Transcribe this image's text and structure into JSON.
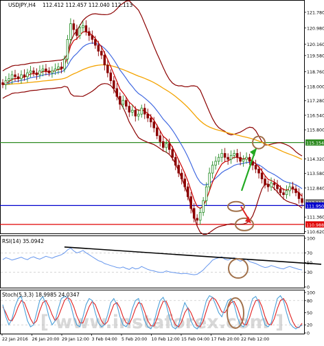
{
  "header": {
    "symbol_timeframe": "USDJPY,H4",
    "ohlc": "112.412 112.457 112.040 112.113"
  },
  "watermark": "www.instaforex.com",
  "colors": {
    "background": "#ffffff",
    "bull_candle": "#228b22",
    "bear_candle": "#8b0000",
    "bollinger": "#8b0000",
    "ema_fast": "#cc0000",
    "ema_mid": "#4169e1",
    "ema_slow": "#f4a300",
    "resistance": "#2e8b22",
    "support": "#0000cd",
    "target_low": "#e00000",
    "rsi_line": "#6495ed",
    "stoch_main": "#4a9fd8",
    "stoch_signal": "#e02020",
    "annotation_circle": "#a0704a",
    "trend_line": "#000000",
    "arrow_up": "#22aa22",
    "arrow_down": "#dd2222"
  },
  "chart_data": [
    {
      "type": "candlestick",
      "title": "USDJPY,H4",
      "ylim": [
        110.6,
        122.3
      ],
      "y_ticks": [
        "121.780",
        "120.980",
        "120.160",
        "119.580",
        "118.760",
        "118.000",
        "117.280",
        "116.540",
        "115.800",
        "115.154",
        "114.320",
        "113.580",
        "112.840",
        "112.113",
        "111.950",
        "111.360",
        "110.988",
        "110.620"
      ],
      "price_labels": {
        "current": "112.113",
        "support": "111.950",
        "resistance": "115.154",
        "target_low": "110.988"
      },
      "levels": [
        {
          "name": "resistance",
          "value": 115.154
        },
        {
          "name": "support",
          "value": 111.95
        },
        {
          "name": "target_low",
          "value": 110.988
        }
      ],
      "x_ticks": [
        "22 Jan 2016",
        "26 Jan 20:00",
        "29 Jan 12:00",
        "3 Feb 04:00",
        "5 Feb 20:00",
        "10 Feb 12:00",
        "15 Feb 04:00",
        "17 Feb 20:00",
        "22 Feb 12:00"
      ],
      "closes": [
        118.1,
        118.3,
        118.4,
        118.6,
        118.5,
        118.4,
        118.6,
        118.5,
        118.7,
        118.8,
        118.7,
        118.6,
        118.8,
        118.9,
        118.8,
        118.7,
        118.8,
        118.9,
        119.0,
        118.9,
        119.4,
        120.4,
        121.2,
        120.9,
        120.6,
        121.0,
        121.1,
        120.8,
        120.6,
        120.4,
        120.1,
        119.8,
        119.6,
        119.1,
        118.7,
        118.3,
        117.9,
        117.5,
        117.1,
        117.3,
        117.0,
        116.7,
        116.8,
        116.5,
        116.6,
        116.9,
        116.6,
        116.4,
        116.2,
        115.9,
        115.5,
        115.2,
        114.9,
        115.1,
        114.8,
        114.4,
        114.0,
        113.6,
        113.3,
        112.9,
        112.4,
        111.8,
        111.3,
        111.2,
        111.6,
        112.2,
        112.9,
        113.6,
        114.0,
        114.2,
        114.4,
        114.6,
        114.4,
        114.3,
        114.5,
        114.6,
        114.4,
        114.2,
        114.3,
        114.4,
        114.2,
        114.0,
        113.8,
        113.6,
        113.3,
        113.0,
        112.9,
        113.1,
        113.0,
        112.8,
        112.6,
        112.5,
        112.7,
        112.9,
        112.8,
        112.6,
        112.3,
        112.1
      ],
      "annotations": [
        "circle-resistance-target",
        "circle-current-price",
        "circle-low-target",
        "arrow-up",
        "arrow-down"
      ]
    },
    {
      "type": "line",
      "title": "RSI(14) 35.0942",
      "ylim": [
        0,
        100
      ],
      "y_ticks": [
        "100",
        "70",
        "50",
        "30",
        "0"
      ],
      "series": [
        {
          "name": "RSI(14)",
          "values": [
            56,
            60,
            58,
            55,
            57,
            59,
            61,
            58,
            56,
            60,
            62,
            59,
            57,
            60,
            63,
            61,
            59,
            62,
            64,
            66,
            70,
            76,
            80,
            74,
            70,
            72,
            75,
            70,
            66,
            62,
            58,
            54,
            52,
            48,
            46,
            44,
            42,
            40,
            39,
            41,
            38,
            36,
            40,
            37,
            38,
            42,
            39,
            36,
            34,
            33,
            31,
            30,
            30,
            33,
            31,
            30,
            29,
            28,
            27,
            28,
            27,
            26,
            25,
            26,
            30,
            35,
            42,
            48,
            55,
            58,
            60,
            62,
            57,
            55,
            58,
            60,
            56,
            53,
            55,
            57,
            52,
            50,
            48,
            45,
            42,
            40,
            41,
            44,
            42,
            40,
            38,
            37,
            40,
            42,
            40,
            38,
            36,
            35
          ]
        }
      ],
      "trend_line": {
        "from_index": 20,
        "from_value": 82,
        "to_index": 97,
        "to_value": 55
      }
    },
    {
      "type": "line",
      "title": "Stoch(5,3,3) 18.9985 24.0347",
      "ylim": [
        0,
        100
      ],
      "y_ticks": [
        "100",
        "80",
        "50",
        "20",
        "0"
      ],
      "series": [
        {
          "name": "Stoch(5,3,3)",
          "values": [
            70,
            40,
            20,
            35,
            65,
            85,
            90,
            60,
            30,
            15,
            20,
            50,
            80,
            90,
            70,
            40,
            20,
            30,
            60,
            85,
            90,
            88,
            70,
            40,
            20,
            15,
            40,
            70,
            85,
            80,
            50,
            25,
            15,
            20,
            45,
            75,
            85,
            70,
            40,
            20,
            15,
            30,
            60,
            80,
            85,
            60,
            30,
            15,
            10,
            25,
            55,
            80,
            88,
            70,
            40,
            15,
            10,
            20,
            50,
            75,
            60,
            30,
            15,
            10,
            20,
            50,
            80,
            92,
            88,
            70,
            50,
            40,
            60,
            80,
            85,
            70,
            40,
            20,
            15,
            30,
            60,
            85,
            90,
            75,
            45,
            20,
            15,
            25,
            55,
            85,
            92,
            80,
            50,
            25,
            15,
            10,
            15,
            19
          ]
        },
        {
          "name": "signal",
          "values": [
            65,
            50,
            32,
            30,
            45,
            65,
            80,
            75,
            55,
            35,
            22,
            30,
            55,
            75,
            80,
            65,
            45,
            30,
            40,
            60,
            80,
            88,
            82,
            65,
            42,
            25,
            25,
            45,
            65,
            78,
            70,
            50,
            30,
            20,
            28,
            50,
            70,
            75,
            62,
            40,
            25,
            22,
            38,
            60,
            75,
            72,
            52,
            30,
            18,
            17,
            35,
            60,
            78,
            78,
            60,
            35,
            20,
            15,
            28,
            50,
            62,
            50,
            32,
            18,
            15,
            30,
            55,
            78,
            88,
            82,
            68,
            52,
            50,
            62,
            75,
            78,
            62,
            40,
            22,
            20,
            38,
            62,
            80,
            82,
            65,
            40,
            22,
            20,
            35,
            60,
            80,
            85,
            72,
            48,
            28,
            15,
            13,
            24
          ]
        }
      ]
    }
  ]
}
